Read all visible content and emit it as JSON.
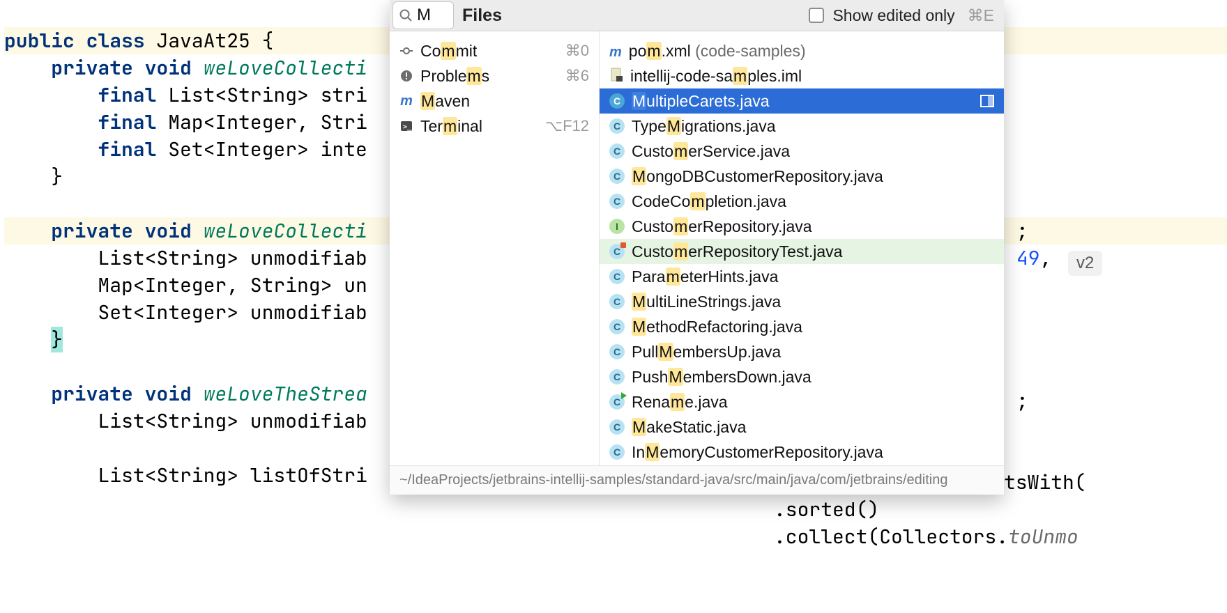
{
  "code": {
    "l1a": "public",
    "l1b": " class",
    "l1c": " JavaAt25 {",
    "l2a": "    private",
    "l2b": " void ",
    "l2c": "weLoveCollecti",
    "l3a": "        final",
    "l3b": " List<String> stri",
    "l4a": "        final",
    "l4b": " Map<Integer, Stri",
    "l5a": "        final",
    "l5b": " Set<Integer> inte",
    "l6": "    }",
    "l8a": "    private",
    "l8b": " void ",
    "l8c": "weLoveCollecti",
    "l9": "        List<String> unmodifiab",
    "l10": "        Map<Integer, String> un",
    "l11": "        Set<Integer> unmodifiab",
    "l12": "    ",
    "l12b": "}",
    "l14a": "    private",
    "l14b": " void ",
    "l14c": "weLoveTheStrea",
    "l15": "        List<String> unmodifiab",
    "l17": "        List<String> listOfStri",
    "r1": "tsWith(",
    "r2": ".sorted()",
    "r3": ".collect(Collectors.",
    "r3b": "toUnmo",
    "r_semi": ";",
    "r_num": "49",
    "r_comma": ", ",
    "v2": "v2"
  },
  "popup": {
    "search_value": "M",
    "header_title": "Files",
    "show_edited_label": "Show edited only",
    "show_edited_shortcut": "⌘E",
    "footer_path": "~/IdeaProjects/jetbrains-intellij-samples/standard-java/src/main/java/com/jetbrains/editing",
    "left": [
      {
        "icon": "commit",
        "parts": [
          "Co",
          "m",
          "mit"
        ],
        "shortcut": "⌘0"
      },
      {
        "icon": "problems",
        "parts": [
          "Proble",
          "m",
          "s"
        ],
        "shortcut": "⌘6"
      },
      {
        "icon": "maven",
        "parts": [
          "",
          "M",
          "aven"
        ],
        "shortcut": ""
      },
      {
        "icon": "terminal",
        "parts": [
          "Ter",
          "m",
          "inal"
        ],
        "shortcut": "⌥F12"
      }
    ],
    "files": [
      {
        "icon": "m",
        "badge": "m-blue",
        "parts": [
          "po",
          "m",
          ".xml "
        ],
        "tail": "(code-samples)",
        "sel": false
      },
      {
        "icon": "iml",
        "badge": "iml",
        "parts": [
          "intellij-code-sa",
          "m",
          "ples.iml"
        ],
        "sel": false
      },
      {
        "icon": "c",
        "badge": "c-sel",
        "parts": [
          "",
          "M",
          "ultipleCarets.java"
        ],
        "sel": true,
        "split": true
      },
      {
        "icon": "c",
        "badge": "c",
        "parts": [
          "Type",
          "M",
          "igrations.java"
        ],
        "sel": false
      },
      {
        "icon": "c",
        "badge": "c",
        "parts": [
          "Custo",
          "m",
          "erService.java"
        ],
        "sel": false
      },
      {
        "icon": "c",
        "badge": "c",
        "parts": [
          "",
          "M",
          "ongoDBCustomerRepository.java"
        ],
        "sel": false
      },
      {
        "icon": "c",
        "badge": "c",
        "parts": [
          "CodeCo",
          "m",
          "pletion.java"
        ],
        "sel": false
      },
      {
        "icon": "i",
        "badge": "i",
        "parts": [
          "Custo",
          "m",
          "erRepository.java"
        ],
        "sel": false
      },
      {
        "icon": "c",
        "badge": "test",
        "parts": [
          "Custo",
          "m",
          "erRepositoryTest.java"
        ],
        "sel": false,
        "test": true
      },
      {
        "icon": "c",
        "badge": "c",
        "parts": [
          "Para",
          "m",
          "eterHints.java"
        ],
        "sel": false
      },
      {
        "icon": "c",
        "badge": "c",
        "parts": [
          "",
          "M",
          "ultiLineStrings.java"
        ],
        "sel": false
      },
      {
        "icon": "c",
        "badge": "c",
        "parts": [
          "",
          "M",
          "ethodRefactoring.java"
        ],
        "sel": false
      },
      {
        "icon": "c",
        "badge": "c",
        "parts": [
          "Pull",
          "M",
          "embersUp.java"
        ],
        "sel": false
      },
      {
        "icon": "c",
        "badge": "c",
        "parts": [
          "Push",
          "M",
          "embersDown.java"
        ],
        "sel": false
      },
      {
        "icon": "c",
        "badge": "run",
        "parts": [
          "Rena",
          "m",
          "e.java"
        ],
        "sel": false
      },
      {
        "icon": "c",
        "badge": "c",
        "parts": [
          "",
          "M",
          "akeStatic.java"
        ],
        "sel": false
      },
      {
        "icon": "c",
        "badge": "c",
        "parts": [
          "In",
          "M",
          "emoryCustomerRepository.java"
        ],
        "sel": false
      }
    ]
  }
}
